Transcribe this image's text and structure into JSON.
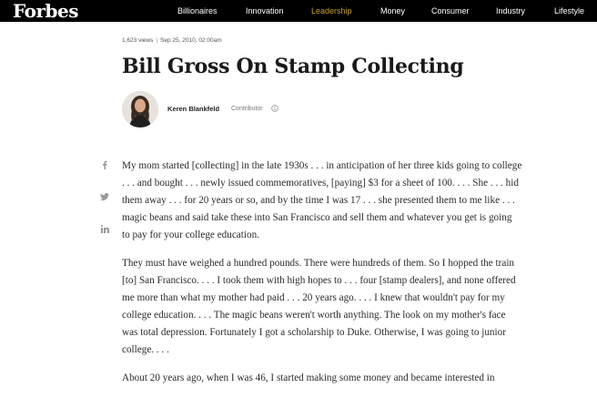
{
  "site": {
    "logo": "Forbes",
    "nav": [
      "Billionaires",
      "Innovation",
      "Leadership",
      "Money",
      "Consumer",
      "Industry",
      "Lifestyle"
    ],
    "active_nav": "Leadership",
    "accent_color": "#c9a227"
  },
  "article": {
    "views": "1,623 views",
    "date": "Sep 25, 2010, 02:00am",
    "title": "Bill Gross On Stamp Collecting",
    "author": {
      "name": "Keren Blankfeld",
      "role": "Contributor",
      "info_icon": "info-circle-icon"
    },
    "share_icons": [
      "facebook-icon",
      "twitter-icon",
      "linkedin-icon"
    ],
    "paragraphs": [
      [
        "My mom started [collecting] in the late 1930s . . . in anticipation of her three kids going to college",
        ". . . and bought . . . newly issued commemoratives, [paying] $3 for a sheet of 100. . . . She . . . hid",
        "them away . . . for 20 years or so, and by the time I was 17 . . . she presented them to me like . . .",
        "magic beans and said take these into San Francisco and sell them and whatever you get is going",
        "to pay for your college education."
      ],
      [
        "They must have weighed a hundred pounds. There were hundreds of them. So I hopped the train",
        "[to] San Francisco. . . . I took them with high hopes to . . . four [stamp dealers], and none offered",
        "me more than what my mother had paid . . . 20 years ago. . . . I knew that wouldn't pay for my",
        "college education. . . . The magic beans weren't worth anything. The look on my mother's face",
        "was total depression. Fortunately I got a scholarship to Duke. Otherwise, I was going to junior",
        "college. . . ."
      ],
      [
        "About 20 years ago, when I was 46, I started making some money and became interested in"
      ]
    ]
  }
}
